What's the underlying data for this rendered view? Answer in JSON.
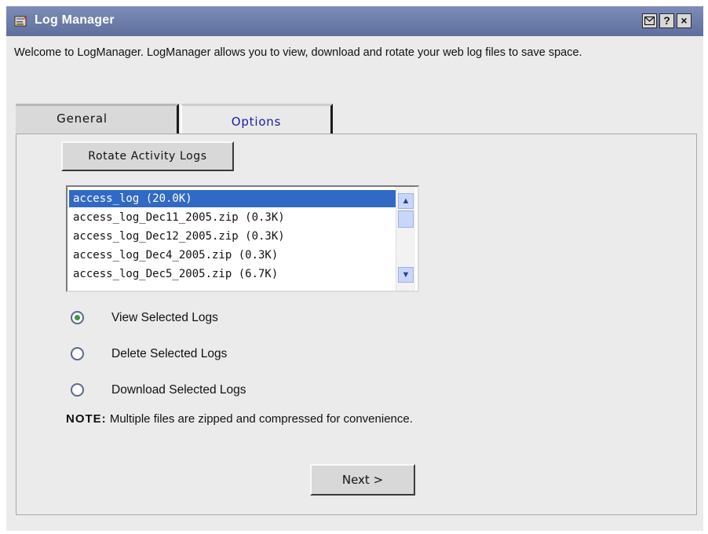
{
  "window": {
    "title": "Log Manager",
    "app_icon": "log-manager-icon",
    "controls": {
      "minimize_icon": "envelope-icon",
      "help": "?",
      "close": "×"
    }
  },
  "welcome_text": "Welcome to LogManager. LogManager allows you to view, download and rotate your web log files to save space.",
  "tabs": [
    {
      "label": "General",
      "active": false
    },
    {
      "label": "Options",
      "active": true
    }
  ],
  "rotate_button_label": "Rotate Activity Logs",
  "log_files": [
    {
      "label": "access_log (20.0K)",
      "selected": true
    },
    {
      "label": "access_log_Dec11_2005.zip (0.3K)",
      "selected": false
    },
    {
      "label": "access_log_Dec12_2005.zip (0.3K)",
      "selected": false
    },
    {
      "label": "access_log_Dec4_2005.zip (0.3K)",
      "selected": false
    },
    {
      "label": "access_log_Dec5_2005.zip (6.7K)",
      "selected": false
    }
  ],
  "actions": [
    {
      "label": "View Selected Logs",
      "checked": true
    },
    {
      "label": "Delete Selected Logs",
      "checked": false
    },
    {
      "label": "Download Selected Logs",
      "checked": false
    }
  ],
  "note": {
    "prefix": "NOTE:",
    "text": " Multiple files are zipped and compressed for convenience."
  },
  "next_button_label": "Next >",
  "colors": {
    "titlebar": "#6a79a6",
    "selection": "#316ac5",
    "options_tab_text": "#1a1aa8",
    "radio_dot": "#3a9a3a"
  }
}
